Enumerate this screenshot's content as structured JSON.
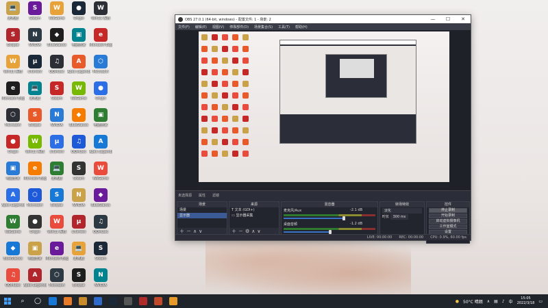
{
  "desktop": {
    "icons": [
      {
        "label": "此电脑",
        "glyph": "💻",
        "color": "#c9a24a"
      },
      {
        "label": "Eclipse",
        "glyph": "S",
        "color": "#1e1e1e"
      },
      {
        "label": "Win11 系统",
        "glyph": "W",
        "color": "#2a7bd6"
      },
      {
        "label": "Microsoft Edge",
        "glyph": "e",
        "color": "#1878d6"
      },
      {
        "label": "Microsoft",
        "glyph": "⬡",
        "color": "#2d3a44"
      },
      {
        "label": "Origin",
        "glyph": "●",
        "color": "#e85a2a"
      },
      {
        "label": "电脑管家",
        "glyph": "▣",
        "color": "#1e5ad8"
      },
      {
        "label": "Apex Legends",
        "glyph": "A",
        "color": "#b0262c"
      },
      {
        "label": "WeGame",
        "glyph": "W",
        "color": "#2d2f36"
      },
      {
        "label": "BlueStacks",
        "glyph": "◆",
        "color": "#2b6ee6"
      },
      {
        "label": "QQMusic",
        "glyph": "♫",
        "color": "#e94b3c"
      },
      {
        "label": "Steam",
        "glyph": "S",
        "color": "#1b2838"
      },
      {
        "label": "NVIDIA",
        "glyph": "N",
        "color": "#76b900"
      },
      {
        "label": "uTorrent",
        "glyph": "μ",
        "color": "#333"
      }
    ]
  },
  "obs": {
    "title": "OBS 27.0.1 (64-bit, windows) - 配置文件: 1 - 场景: 2",
    "menu": [
      "文件(F)",
      "编辑(E)",
      "视图(V)",
      "停靠部件(D)",
      "场景集合(S)",
      "工具(T)",
      "帮助(H)"
    ],
    "docks_header": [
      "未选择源",
      "属性",
      "滤镜"
    ],
    "scenes": {
      "title": "场景",
      "items": [
        "场景",
        "显示器"
      ]
    },
    "sources": {
      "title": "来源",
      "items": [
        "文本 (GDI+)",
        "显示器采集"
      ]
    },
    "mixer": {
      "title": "混音器",
      "channels": [
        {
          "name": "麦克风/Aux",
          "db": "-2.1 dB"
        },
        {
          "name": "桌面音频",
          "db": "-1.2 dB"
        }
      ]
    },
    "transitions": {
      "title": "转场特效",
      "type": "淡化",
      "duration_label": "时长",
      "duration": "300 ms"
    },
    "controls": {
      "title": "控件",
      "buttons": [
        "停止录制",
        "开始录制",
        "启动虚拟摄像机",
        "工作室模式",
        "设置",
        "退出"
      ]
    },
    "status": {
      "live": "LIVE: 00:00:00",
      "rec": "REC: 00:00:00",
      "cpu": "CPU: 0.9%, 60.00 fps"
    },
    "window_buttons": [
      "—",
      "☐",
      "✕"
    ]
  },
  "taskbar": {
    "weather": "50°C 晴朗",
    "time": "15:05",
    "date": "2022/3/18",
    "lang": "中"
  }
}
